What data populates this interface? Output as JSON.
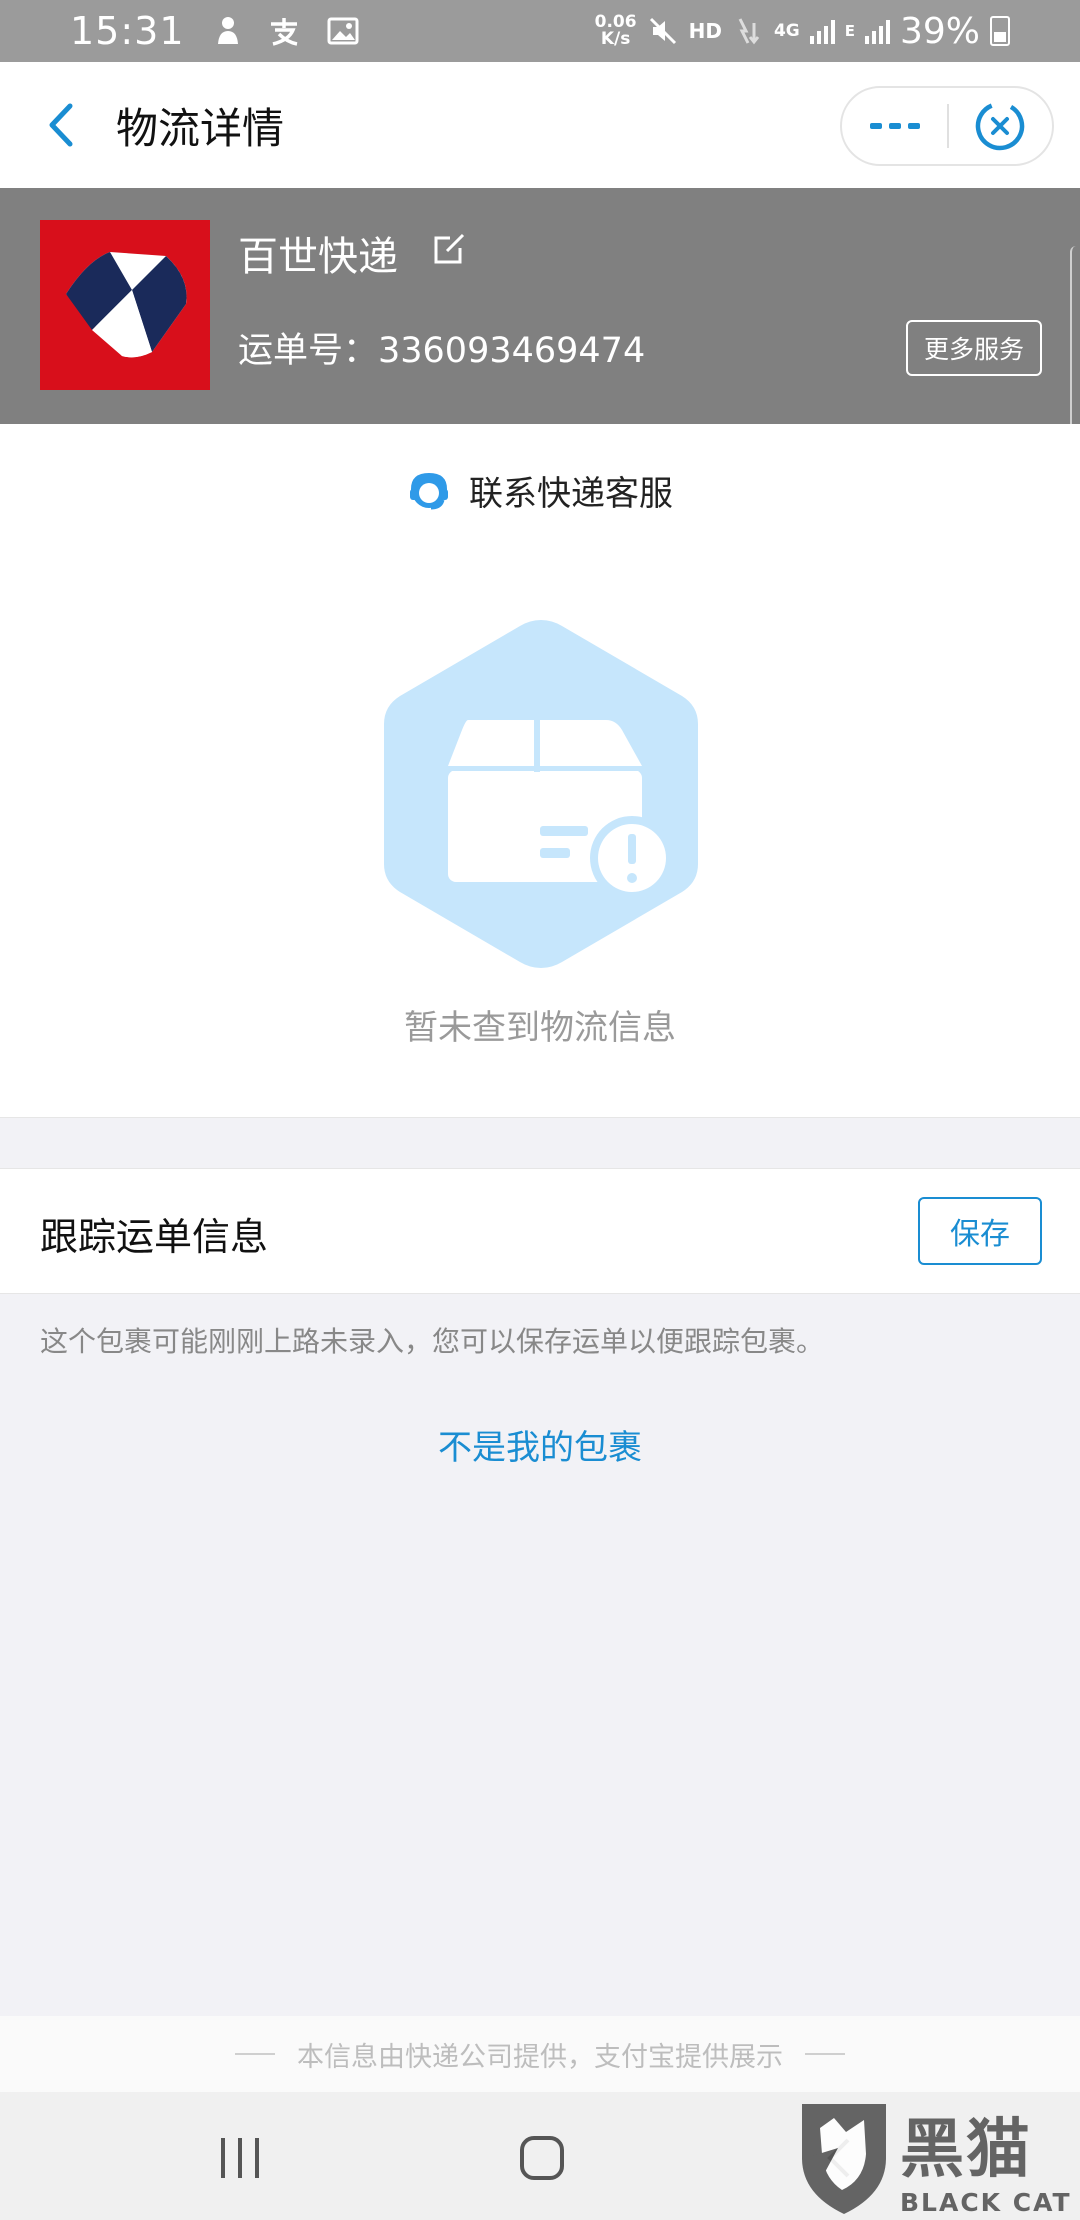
{
  "status_bar": {
    "time": "15:31",
    "net_speed_value": "0.06",
    "net_speed_unit": "K/s",
    "hd": "HD",
    "network_4g": "4G",
    "network_e": "E",
    "battery": "39%",
    "icons": [
      "person-icon",
      "alipay-icon",
      "image-icon",
      "mute-icon",
      "data-transfer-icon",
      "signal-icon",
      "battery-icon"
    ]
  },
  "header": {
    "title": "物流详情"
  },
  "courier": {
    "name": "百世快递",
    "waybill": "运单号：336093469474",
    "more_services": "更多服务",
    "logo_color": "#d80f1b"
  },
  "main": {
    "contact_label": "联系快递客服",
    "empty_text": "暂未查到物流信息"
  },
  "tracking": {
    "title": "跟踪运单信息",
    "save_label": "保存",
    "hint": "这个包裹可能刚刚上路未录入，您可以保存运单以便跟踪包裹。",
    "not_mine": "不是我的包裹"
  },
  "footer": {
    "note": "本信息由快递公司提供，支付宝提供展示"
  },
  "watermark": {
    "cn": "黑猫",
    "en": "BLACK CAT"
  },
  "colors": {
    "accent": "#1a8dd2",
    "card_bg": "#808080",
    "status_bar": "#9b9b9b",
    "illustration": "#c6e6fc"
  }
}
